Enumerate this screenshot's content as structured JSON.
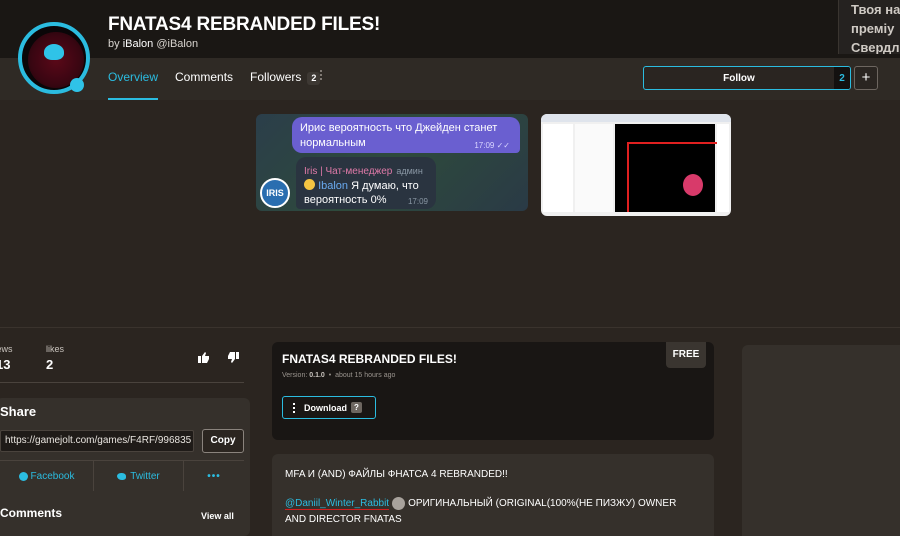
{
  "header": {
    "title": "FNATAS4 REBRANDED FILES!",
    "by_prefix": "by",
    "author_name": "iBalon",
    "author_handle": "@iBalon"
  },
  "ad": {
    "lines": [
      "Твоя на",
      "преміу",
      "Свердл"
    ]
  },
  "tabs": [
    {
      "label": "Overview",
      "active": true
    },
    {
      "label": "Comments",
      "active": false
    },
    {
      "label": "Followers",
      "count": "2",
      "active": false
    }
  ],
  "follow": {
    "label": "Follow",
    "count": "2",
    "plus": "+"
  },
  "media": {
    "chat": {
      "outgoing_text": "Ирис вероятность что Джейден станет нормальным",
      "outgoing_time": "17:09",
      "avatar_text": "IRIS",
      "sender_name": "Iris | Чат-менеджер",
      "sender_role": "админ",
      "reply_mention": "Ibalon",
      "reply_text": " Я думаю, что вероятность 0%",
      "reply_time": "17:09"
    }
  },
  "stats": {
    "views_label": "views",
    "views_value": "13",
    "likes_label": "likes",
    "likes_value": "2"
  },
  "share": {
    "title": "Share",
    "url": "https://gamejolt.com/games/F4RF/996835",
    "copy_label": "Copy",
    "facebook_label": "Facebook",
    "twitter_label": "Twitter",
    "more_label": "•••"
  },
  "comments": {
    "title": "Comments",
    "view_all": "View all"
  },
  "package": {
    "title": "FNATAS4 REBRANDED FILES!",
    "version_label": "Version:",
    "version": "0.1.0",
    "separator": "•",
    "updated": "about 15 hours ago",
    "price_badge": "FREE",
    "download_label": "Download",
    "download_q": "?"
  },
  "description": {
    "line1": "MFA И (AND) ФАЙЛЫ ФНАТСА 4 REBRANDED!!",
    "mention": "@Daniil_Winter_Rabbit",
    "line2_rest": "ОРИГИНАЛЬНЫЙ (ORIGINAL(100%(НЕ ПИЗЖУ) OWNER",
    "line3": "AND DIRECTOR FNATAS"
  },
  "colors": {
    "accent": "#2bbce0",
    "background": "#2b2520",
    "card": "#35302b"
  }
}
